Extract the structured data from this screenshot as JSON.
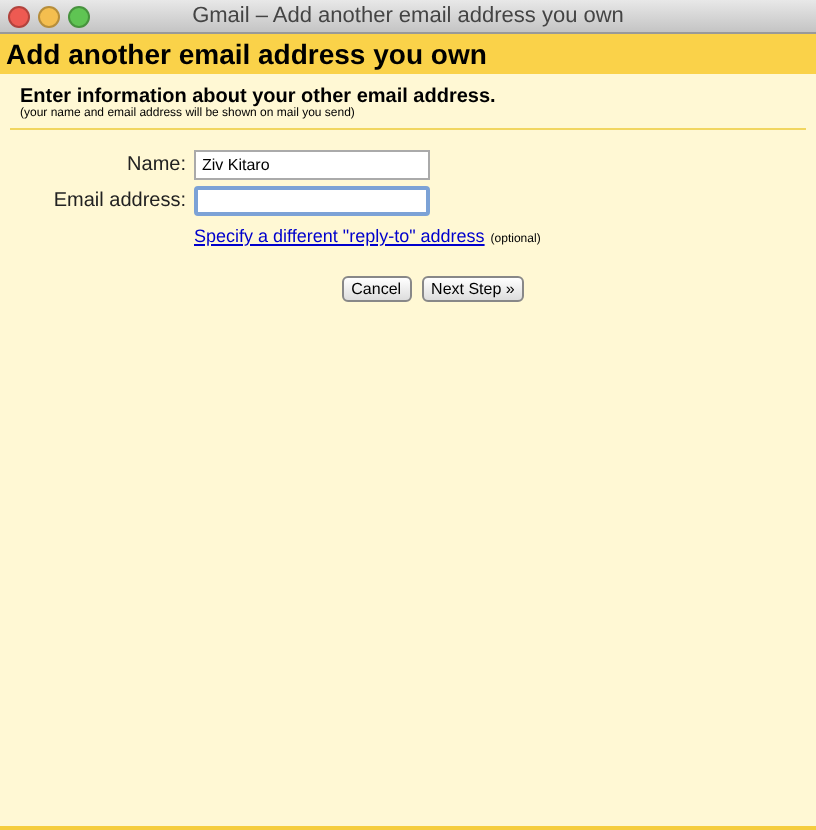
{
  "window": {
    "title": "Gmail – Add another email address you own"
  },
  "header": "Add another email address you own",
  "intro": {
    "heading": "Enter information about your other email address.",
    "note": "(your name and email address will be shown on mail you send)"
  },
  "fields": [
    {
      "label": "Name:",
      "value": "Ziv Kitaro",
      "focused": false
    },
    {
      "label": "Email address:",
      "focused": true
    }
  ],
  "reply_to": {
    "link": "Specify a different \"reply-to\" address",
    "note": "(optional)"
  },
  "buttons": [
    "Cancel",
    "Next Step »"
  ]
}
